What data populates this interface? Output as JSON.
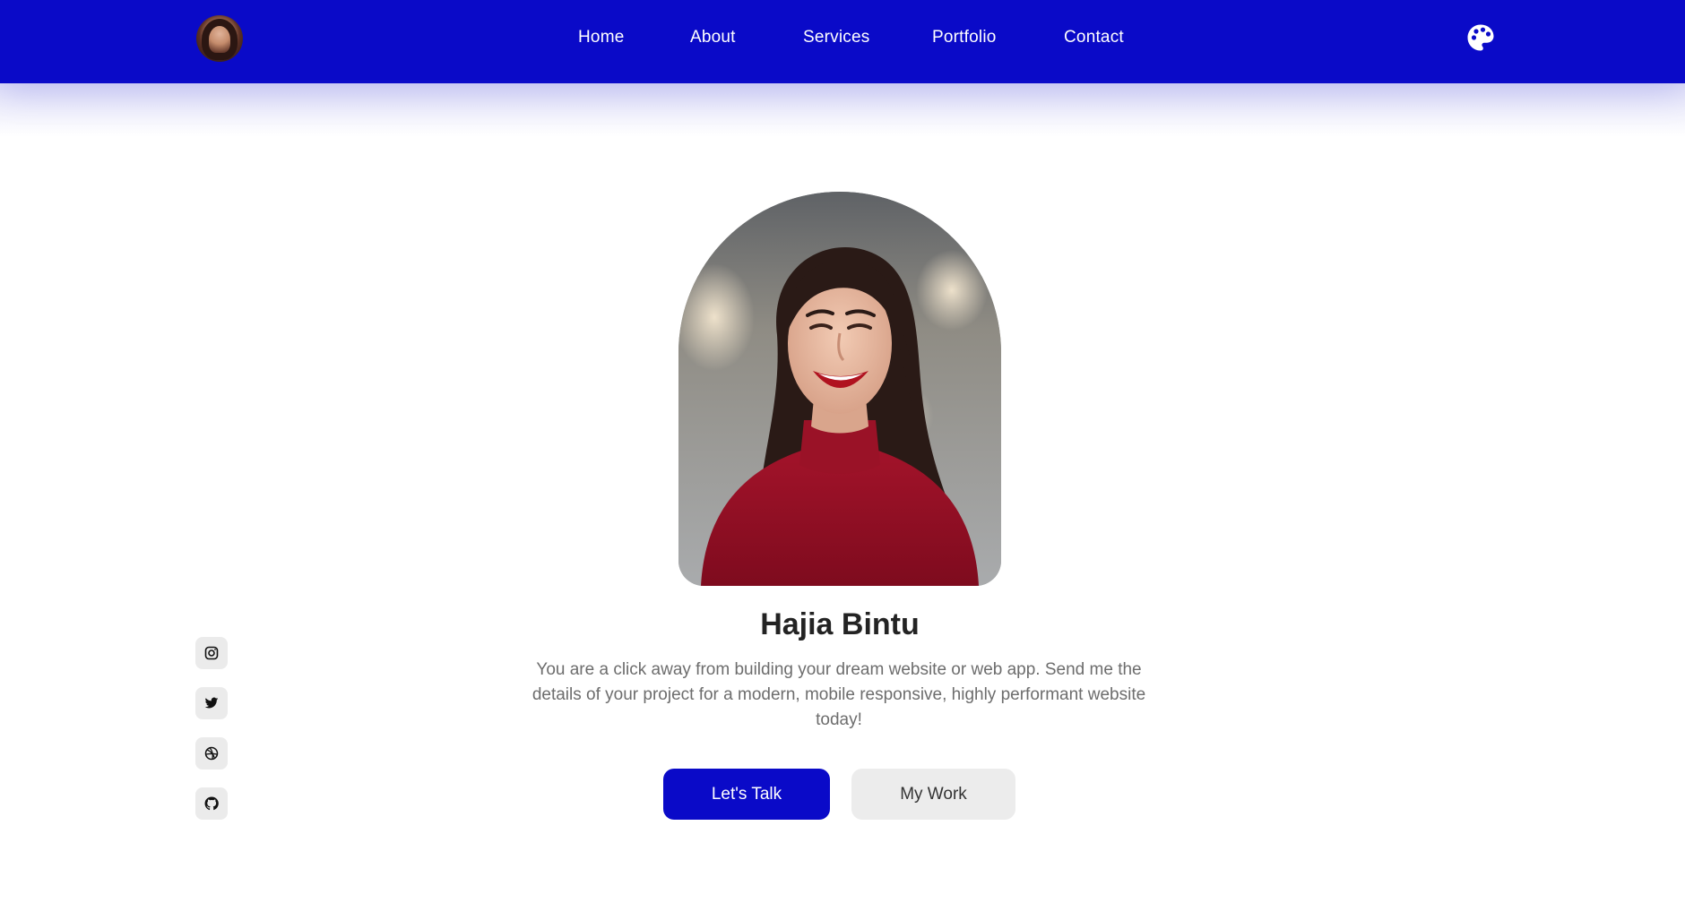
{
  "nav": {
    "links": [
      "Home",
      "About",
      "Services",
      "Portfolio",
      "Contact"
    ],
    "avatar_icon": "profile-avatar",
    "theme_icon": "palette-icon",
    "background_color": "#0a0ac8"
  },
  "hero": {
    "name": "Hajia Bintu",
    "description": "You are a click away from building your dream website or web app. Send me the details of your project for a modern, mobile responsive, highly performant website today!",
    "primary_button": "Let's Talk",
    "secondary_button": "My Work",
    "photo_icon": "portrait-photo"
  },
  "social": {
    "items": [
      "instagram-icon",
      "twitter-icon",
      "dribbble-icon",
      "github-icon"
    ]
  },
  "colors": {
    "accent": "#0a0ac8",
    "heading": "#232323",
    "body_text": "#6d6d6d",
    "secondary_button_bg": "#ececec"
  }
}
